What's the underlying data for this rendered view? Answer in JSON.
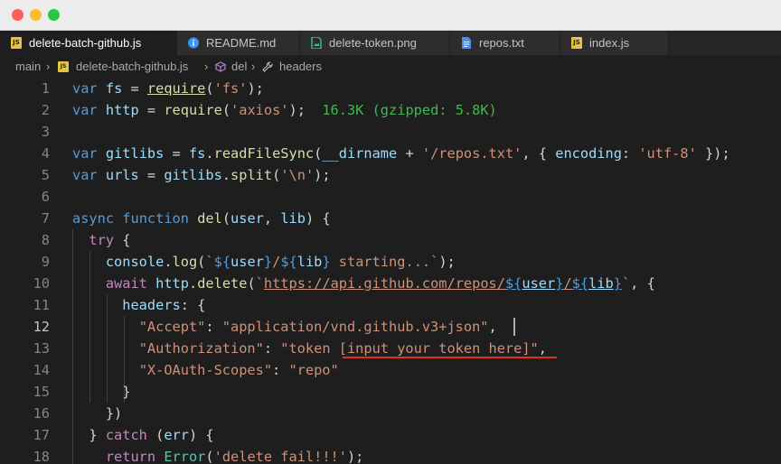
{
  "window": {
    "controls": [
      "close",
      "minimize",
      "maximize"
    ]
  },
  "tabs": [
    {
      "label": "delete-batch-github.js",
      "icon": "js-file-icon",
      "badge": "JS",
      "active": true
    },
    {
      "label": "README.md",
      "icon": "info-icon",
      "active": false
    },
    {
      "label": "delete-token.png",
      "icon": "image-file-icon",
      "active": false
    },
    {
      "label": "repos.txt",
      "icon": "text-file-icon",
      "active": false
    },
    {
      "label": "index.js",
      "icon": "js-file-icon",
      "badge": "JS",
      "active": false
    }
  ],
  "breadcrumb": {
    "root": "main",
    "file": "delete-batch-github.js",
    "function": "del",
    "symbol": "headers",
    "separator": "›"
  },
  "editor": {
    "current_line": 12,
    "line_numbers": [
      "1",
      "2",
      "3",
      "4",
      "5",
      "6",
      "7",
      "8",
      "9",
      "10",
      "11",
      "12",
      "13",
      "14",
      "15",
      "16",
      "17",
      "18"
    ],
    "lines": {
      "l1": {
        "kw_var": "var",
        "fs": "fs",
        "eq": " = ",
        "require": "require",
        "arg": "'fs'",
        "end": ";"
      },
      "l2": {
        "kw_var": "var",
        "http": "http",
        "eq": " = ",
        "require": "require",
        "arg": "'axios'",
        "end": ");",
        "import_cost": "16.3K (gzipped: 5.8K)"
      },
      "l4": {
        "kw_var": "var",
        "name": "gitlibs",
        "fs": "fs",
        "method": "readFileSync",
        "dirname": "__dirname",
        "plus": " + ",
        "path": "'/repos.txt'",
        "key": "encoding",
        "val": "'utf-8'",
        "end": " });"
      },
      "l5": {
        "kw_var": "var",
        "name": "urls",
        "obj": "gitlibs",
        "method": "split",
        "arg": "'\\n'",
        "end": ");"
      },
      "l7": {
        "kw_async": "async",
        "kw_function": "function",
        "name": "del",
        "p1": "user",
        "p2": "lib",
        "end": ") {"
      },
      "l8": {
        "kw": "try",
        "end": " {"
      },
      "l9": {
        "obj": "console",
        "method": "log",
        "tpl_open": "`",
        "user": "user",
        "lib": "lib",
        "tail": " starting...`",
        "end": ");"
      },
      "l10": {
        "kw": "await",
        "obj": "http",
        "method": "delete",
        "url": "https://api.github.com/repos/",
        "user": "user",
        "lib": "lib",
        "end": "`, {"
      },
      "l11": {
        "key": "headers",
        "end": ": {"
      },
      "l12": {
        "key": "\"Accept\"",
        "val": "\"application/vnd.github.v3+json\"",
        "end": ","
      },
      "l13": {
        "key": "\"Authorization\"",
        "val": "\"token [input your token here]\"",
        "end": ","
      },
      "l14": {
        "key": "\"X-OAuth-Scopes\"",
        "val": "\"repo\""
      },
      "l15": {
        "text": "}"
      },
      "l16": {
        "text": "})"
      },
      "l17": {
        "kw": "catch",
        "err": "err",
        "end": ") {"
      },
      "l18": {
        "kw": "return",
        "type": "Error",
        "arg": "'delete fail!!!'",
        "end": ");"
      }
    }
  },
  "colors": {
    "editor_bg": "#1e1e1e",
    "keyword": "#569cd6",
    "control_keyword": "#c586c0",
    "variable": "#9cdcfe",
    "function": "#dcdcaa",
    "string": "#ce9178",
    "type": "#4ec9b0",
    "import_cost": "#3fb950",
    "squiggle": "#e0301e"
  }
}
